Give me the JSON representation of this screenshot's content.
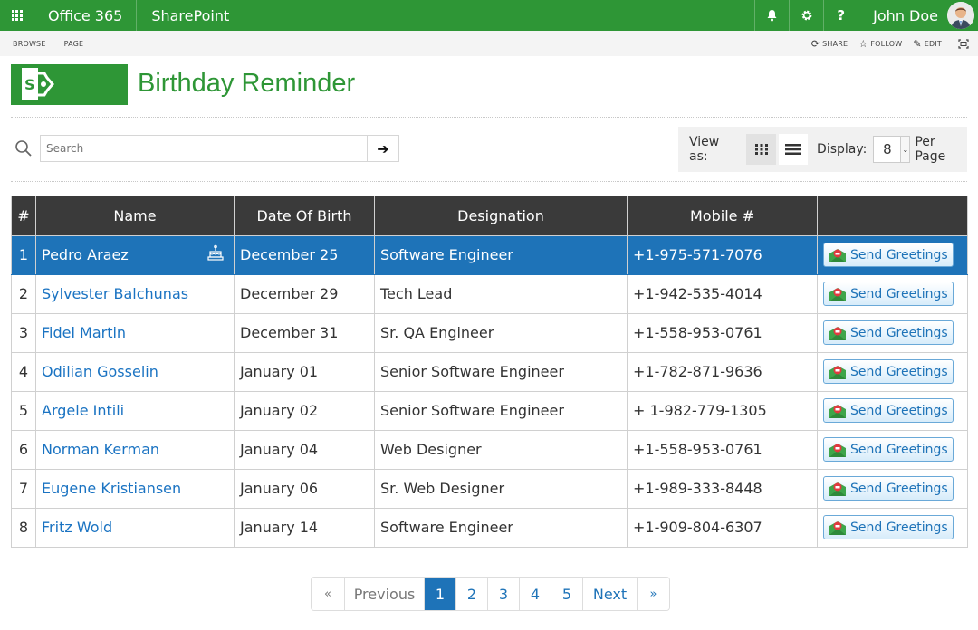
{
  "topbar": {
    "brand": "Office 365",
    "app": "SharePoint",
    "icons": [
      "waffle-icon",
      "bell-icon",
      "gear-icon",
      "help-icon"
    ],
    "help_glyph": "?",
    "user_name": "John Doe"
  },
  "ribbon": {
    "tabs": [
      "BROWSE",
      "PAGE"
    ],
    "actions": [
      {
        "label": "SHARE",
        "icon": "share-icon"
      },
      {
        "label": "FOLLOW",
        "icon": "star-icon"
      },
      {
        "label": "EDIT",
        "icon": "pencil-icon"
      }
    ],
    "focus_icon": "focus-mode-icon"
  },
  "page": {
    "title": "Birthday Reminder",
    "brand_color": "#2e9636",
    "accent_color": "#1e73b8"
  },
  "search": {
    "placeholder": "Search",
    "value": "",
    "go_glyph": "➔"
  },
  "view": {
    "label": "View as:",
    "modes": [
      "grid",
      "list"
    ],
    "active_mode": "grid",
    "display_label": "Display:",
    "per_page_value": "8",
    "per_page_label": "Per Page"
  },
  "table": {
    "headers": [
      "#",
      "Name",
      "Date Of Birth",
      "Designation",
      "Mobile #",
      ""
    ],
    "action_label": "Send Greetings",
    "rows": [
      {
        "num": "1",
        "name": "Pedro Araez",
        "dob": "December 25",
        "designation": "Software Engineer",
        "mobile": "+1-975-571-7076",
        "selected": true,
        "birthday_today": true
      },
      {
        "num": "2",
        "name": "Sylvester Balchunas",
        "dob": "December 29",
        "designation": "Tech Lead",
        "mobile": "+1-942-535-4014"
      },
      {
        "num": "3",
        "name": "Fidel Martin",
        "dob": "December 31",
        "designation": "Sr. QA Engineer",
        "mobile": "+1-558-953-0761"
      },
      {
        "num": "4",
        "name": "Odilian Gosselin",
        "dob": "January 01",
        "designation": "Senior Software Engineer",
        "mobile": "+1-782-871-9636"
      },
      {
        "num": "5",
        "name": "Argele Intili",
        "dob": "January 02",
        "designation": "Senior Software Engineer",
        "mobile": "+ 1-982-779-1305"
      },
      {
        "num": "6",
        "name": "Norman Kerman",
        "dob": "January 04",
        "designation": "Web Designer",
        "mobile": "+1-558-953-0761"
      },
      {
        "num": "7",
        "name": "Eugene Kristiansen",
        "dob": "January 06",
        "designation": "Sr. Web Designer",
        "mobile": "+1-989-333-8448"
      },
      {
        "num": "8",
        "name": "Fritz Wold",
        "dob": "January 14",
        "designation": "Software Engineer",
        "mobile": "+1-909-804-6307"
      }
    ]
  },
  "pagination": {
    "first": "«",
    "previous": "Previous",
    "pages": [
      "1",
      "2",
      "3",
      "4",
      "5"
    ],
    "current": "1",
    "next": "Next",
    "last": "»"
  }
}
